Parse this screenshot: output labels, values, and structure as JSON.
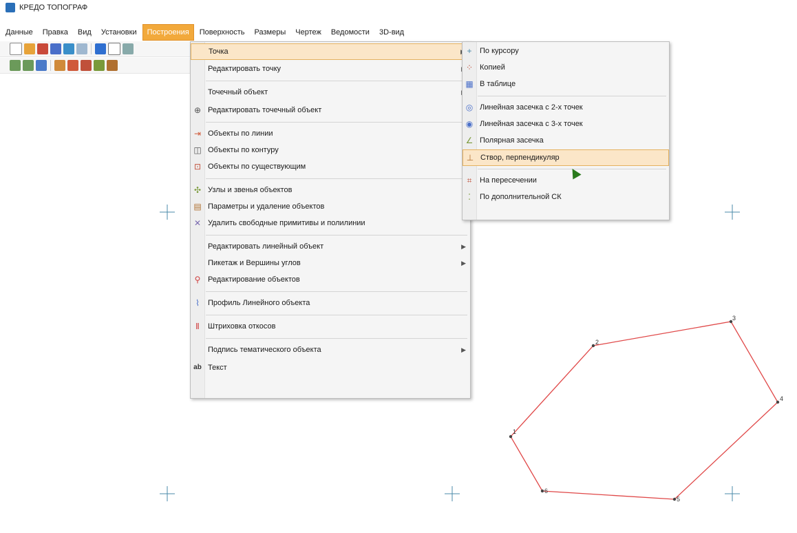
{
  "app": {
    "title": "КРЕДО ТОПОГРАФ"
  },
  "menubar": [
    "Данные",
    "Правка",
    "Вид",
    "Установки",
    "Построения",
    "Поверхность",
    "Размеры",
    "Чертеж",
    "Ведомости",
    "3D-вид"
  ],
  "main_menu": {
    "items": [
      {
        "label": "Точка",
        "submenu": true,
        "highlight": true,
        "icon": "point-icon"
      },
      {
        "label": "Редактировать точку",
        "submenu": true,
        "icon": ""
      },
      {
        "label": "Точечный объект",
        "submenu": true,
        "icon": ""
      },
      {
        "label": "Редактировать точечный объект",
        "submenu": false,
        "icon": "edit-point-object-icon"
      },
      {
        "label": "Объекты по линии",
        "submenu": false,
        "icon": "line-objects-icon"
      },
      {
        "label": "Объекты по контуру",
        "submenu": false,
        "icon": "contour-objects-icon"
      },
      {
        "label": "Объекты по существующим",
        "submenu": false,
        "icon": "existing-objects-icon"
      },
      {
        "label": "Узлы и звенья объектов",
        "submenu": false,
        "icon": "nodes-icon"
      },
      {
        "label": "Параметры и удаление объектов",
        "submenu": false,
        "icon": "params-icon"
      },
      {
        "label": "Удалить свободные примитивы и полилинии",
        "submenu": false,
        "icon": "delete-primitives-icon"
      },
      {
        "label": "Редактировать линейный объект",
        "submenu": true,
        "icon": ""
      },
      {
        "label": "Пикетаж и Вершины углов",
        "submenu": true,
        "icon": ""
      },
      {
        "label": "Редактирование объектов",
        "submenu": false,
        "icon": "edit-objects-icon"
      },
      {
        "label": "Профиль Линейного объекта",
        "submenu": false,
        "icon": "profile-icon"
      },
      {
        "label": "Штриховка откосов",
        "submenu": false,
        "icon": "hatching-icon"
      },
      {
        "label": "Подпись тематического объекта",
        "submenu": true,
        "icon": ""
      },
      {
        "label": "Текст",
        "submenu": false,
        "icon": "text-icon"
      }
    ]
  },
  "sub_menu": {
    "items": [
      {
        "label": "По курсору",
        "icon": "cursor-icon"
      },
      {
        "label": "Копией",
        "icon": "copy-icon"
      },
      {
        "label": "В таблице",
        "icon": "table-icon"
      },
      {
        "label": "Линейная засечка с 2-х точек",
        "icon": "linear-2-icon"
      },
      {
        "label": "Линейная засечка с 3-х точек",
        "icon": "linear-3-icon"
      },
      {
        "label": "Полярная засечка",
        "icon": "polar-icon"
      },
      {
        "label": "Створ, перпендикуляр",
        "icon": "perpendicular-icon",
        "highlight": true
      },
      {
        "label": "На пересечении",
        "icon": "intersection-icon"
      },
      {
        "label": "По дополнительной СК",
        "icon": "extra-cs-icon"
      }
    ]
  },
  "polygon": {
    "labels": [
      "1",
      "2",
      "3",
      "4",
      "5",
      "6"
    ],
    "stroke": "#e04848"
  }
}
